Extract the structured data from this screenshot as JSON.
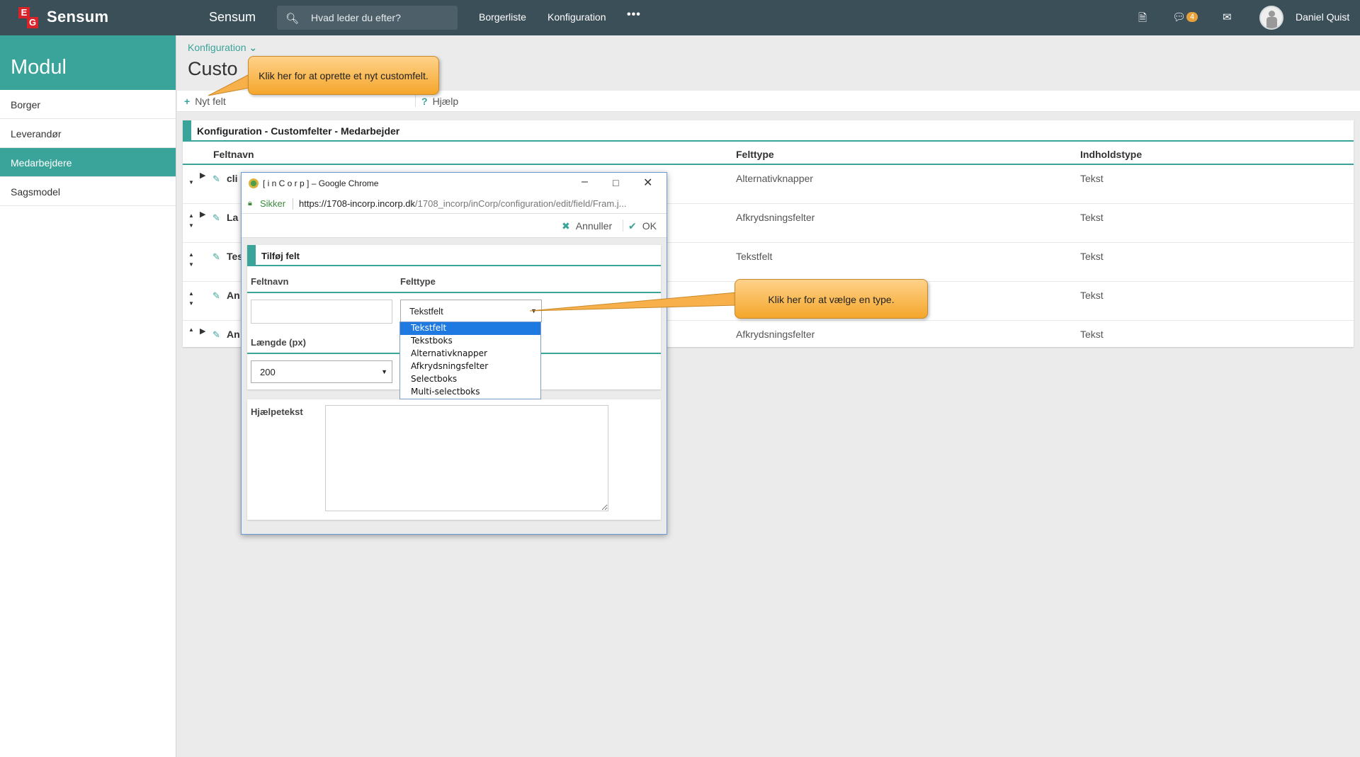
{
  "topbar": {
    "logo_e": "E",
    "logo_g": "G",
    "brand": "Sensum",
    "app_name": "Sensum",
    "search_placeholder": "Hvad leder du efter?",
    "nav": [
      "Borgerliste",
      "Konfiguration"
    ],
    "more": "•••",
    "notification_count": "4",
    "user_name": "Daniel Quist"
  },
  "sidebar": {
    "title": "Modul",
    "items": [
      {
        "label": "Borger",
        "active": false
      },
      {
        "label": "Leverandør",
        "active": false
      },
      {
        "label": "Medarbejdere",
        "active": true
      },
      {
        "label": "Sagsmodel",
        "active": false
      }
    ]
  },
  "main": {
    "breadcrumb": "Konfiguration",
    "title": "Custo",
    "toolbar": {
      "new_field": "Nyt felt",
      "help": "Hjælp"
    },
    "panel_title": "Konfiguration - Customfelter - Medarbejder",
    "columns": [
      "Feltnavn",
      "Felttype",
      "Indholdstype"
    ],
    "rows": [
      {
        "name": "cli",
        "type": "Alternativknapper",
        "content": "Tekst"
      },
      {
        "name": "La",
        "type": "Afkrydsningsfelter",
        "content": "Tekst"
      },
      {
        "name": "Tes",
        "type": "Tekstfelt",
        "content": "Tekst"
      },
      {
        "name": "An",
        "type": "",
        "content": "Tekst"
      },
      {
        "name": "An",
        "type": "Afkrydsningsfelter",
        "content": "Tekst"
      }
    ]
  },
  "popup": {
    "window_title": "[ i n C o r p ] – Google Chrome",
    "secure_label": "Sikker",
    "url_host": "https://1708-incorp.incorp.dk",
    "url_path": "/1708_incorp/inCorp/configuration/edit/field/Fram.j...",
    "cancel": "Annuller",
    "ok": "OK",
    "card_title": "Tilføj felt",
    "label_fieldname": "Feltnavn",
    "label_fieldtype": "Felttype",
    "fieldname_value": "",
    "fieldtype_selected": "Tekstfelt",
    "fieldtype_options": [
      "Tekstfelt",
      "Tekstboks",
      "Alternativknapper",
      "Afkrydsningsfelter",
      "Selectboks",
      "Multi-selectboks"
    ],
    "label_length": "Længde (px)",
    "length_value": "200",
    "label_help": "Hjælpetekst",
    "help_value": ""
  },
  "callouts": {
    "new_field": "Klik her for at oprette et nyt customfelt.",
    "choose_type": "Klik her for at vælge en type."
  },
  "colors": {
    "accent": "#3aa39a",
    "topbar": "#3b4f58",
    "callout": "#f4a62b",
    "badge": "#e8a13a"
  }
}
